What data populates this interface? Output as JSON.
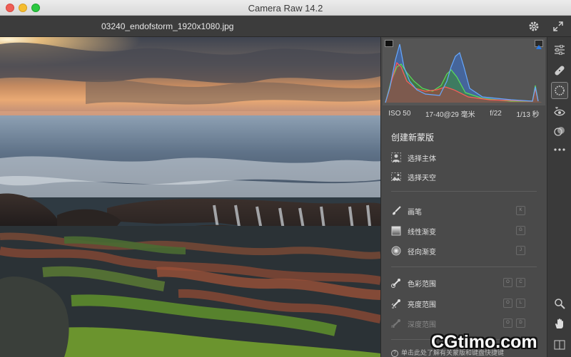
{
  "window": {
    "title": "Camera Raw 14.2"
  },
  "toolbar": {
    "filename": "03240_endofstorm_1920x1080.jpg"
  },
  "histogram_exif": {
    "iso": "ISO 50",
    "lens": "17-40@29 毫米",
    "aperture": "f/22",
    "shutter": "1/13 秒"
  },
  "masking": {
    "header": "创建新蒙版",
    "ai_items": [
      {
        "label": "选择主体",
        "icon": "subject-icon"
      },
      {
        "label": "选择天空",
        "icon": "sky-icon"
      }
    ],
    "tool_items": [
      {
        "label": "画笔",
        "icon": "brush-icon",
        "key": "K"
      },
      {
        "label": "线性渐变",
        "icon": "linear-gradient-icon",
        "key": "G"
      },
      {
        "label": "径向渐变",
        "icon": "radial-gradient-icon",
        "key": "J"
      }
    ],
    "range_items": [
      {
        "label": "色彩范围",
        "icon": "color-range-icon",
        "keys": [
          "O",
          "C"
        ]
      },
      {
        "label": "亮度范围",
        "icon": "luminance-range-icon",
        "keys": [
          "O",
          "L"
        ]
      },
      {
        "label": "深度范围",
        "icon": "depth-range-icon",
        "keys": [
          "O",
          "D"
        ],
        "disabled": true
      }
    ],
    "footer": "单击此处了解有关蒙版和键盘快捷键"
  },
  "watermark": "CGtimo.com",
  "colors": {
    "panel": "#4a4a4a",
    "rail": "#3a3a3a",
    "toolbar": "#3c3c3c",
    "accent": "#2c7be5"
  }
}
